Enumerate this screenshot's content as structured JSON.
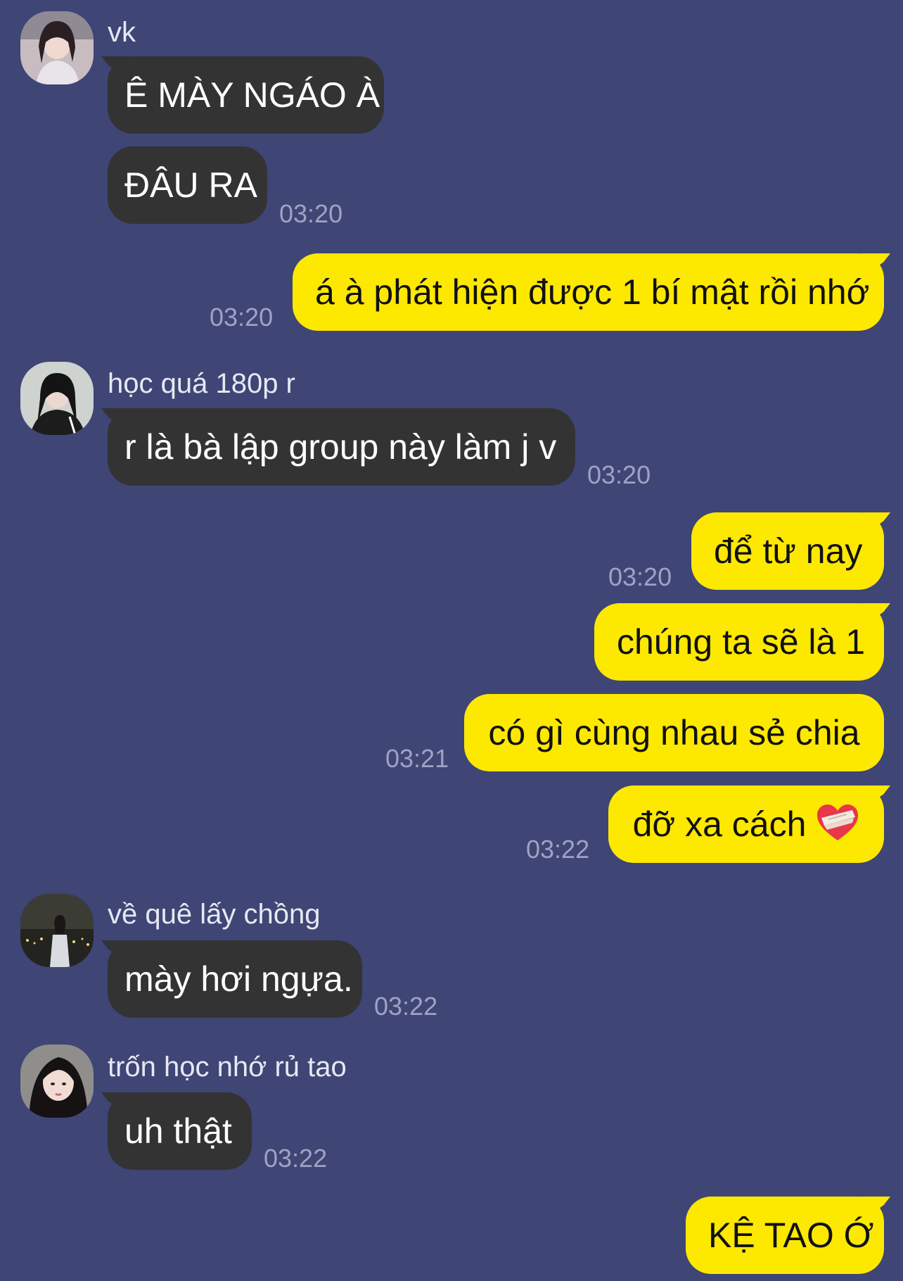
{
  "messages": [
    {
      "sender": "vk"
    },
    {
      "text": "Ê MÀY NGÁO À"
    },
    {
      "text": "ĐÂU RA",
      "time": "03:20"
    },
    {
      "text": "á à phát hiện được 1 bí mật rồi nhớ",
      "time": "03:20"
    },
    {
      "sender": "học quá 180p r",
      "text": "r là bà lập group này làm j v",
      "time": "03:20"
    },
    {
      "text": "để từ nay",
      "time": "03:20"
    },
    {
      "text": "chúng ta sẽ là 1"
    },
    {
      "text": "có gì cùng nhau sẻ chia",
      "time": "03:21"
    },
    {
      "text": "đỡ xa cách",
      "icon": "mending-heart-icon",
      "time": "03:22"
    },
    {
      "sender": "về quê lấy chồng",
      "text": "mày hơi ngựa.",
      "time": "03:22"
    },
    {
      "sender": "trốn học nhớ rủ tao",
      "text": "uh thật",
      "time": "03:22"
    },
    {
      "text": "KỆ TAO Ớ"
    }
  ],
  "colors": {
    "background": "#3f4575",
    "incoming_bubble": "#333333",
    "outgoing_bubble": "#fde800",
    "timestamp": "#9ea3c3"
  }
}
